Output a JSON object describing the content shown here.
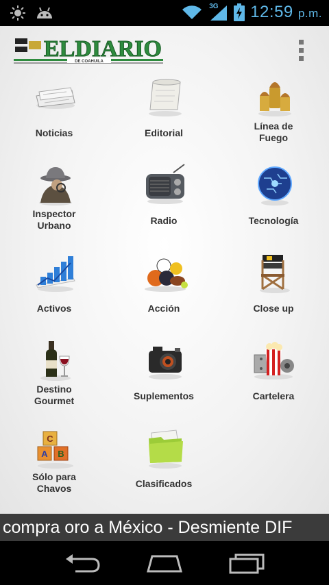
{
  "status_bar": {
    "time": "12:59",
    "ampm": "p.m.",
    "network": "3G",
    "icons": [
      "brightness-icon",
      "android-icon",
      "wifi-icon",
      "signal-icon",
      "battery-charging-icon"
    ]
  },
  "header": {
    "logo_main": "ELDIARIO",
    "logo_sub": "DE COAHUILA",
    "menu_icon": "overflow-menu-icon"
  },
  "sections": [
    {
      "label_1": "Noticias",
      "label_2": "",
      "icon": "newspaper-icon"
    },
    {
      "label_1": "Editorial",
      "label_2": "",
      "icon": "scroll-icon"
    },
    {
      "label_1": "Línea de",
      "label_2": "Fuego",
      "icon": "bullets-icon"
    },
    {
      "label_1": "Inspector",
      "label_2": "Urbano",
      "icon": "detective-icon"
    },
    {
      "label_1": "Radio",
      "label_2": "",
      "icon": "radio-icon"
    },
    {
      "label_1": "Tecnología",
      "label_2": "",
      "icon": "globe-circuit-icon"
    },
    {
      "label_1": "Activos",
      "label_2": "",
      "icon": "bar-chart-icon"
    },
    {
      "label_1": "Acción",
      "label_2": "",
      "icon": "sports-balls-icon"
    },
    {
      "label_1": "Close up",
      "label_2": "",
      "icon": "director-chair-icon"
    },
    {
      "label_1": "Destino",
      "label_2": "Gourmet",
      "icon": "wine-icon"
    },
    {
      "label_1": "Suplementos",
      "label_2": "",
      "icon": "camera-icon"
    },
    {
      "label_1": "Cartelera",
      "label_2": "",
      "icon": "popcorn-film-icon"
    },
    {
      "label_1": "Sólo para",
      "label_2": "Chavos",
      "icon": "toy-blocks-icon"
    },
    {
      "label_1": "Clasificados",
      "label_2": "",
      "icon": "folder-icon"
    }
  ],
  "ticker": {
    "text": "compra oro a México - Desmiente DIF"
  },
  "nav": {
    "icons": [
      "back-icon",
      "home-icon",
      "recent-apps-icon"
    ]
  },
  "colors": {
    "status_blue": "#5fb8e8",
    "logo_green": "#2e8b3e",
    "label_text": "#333333",
    "ticker_bg": "#3b3b3b"
  }
}
